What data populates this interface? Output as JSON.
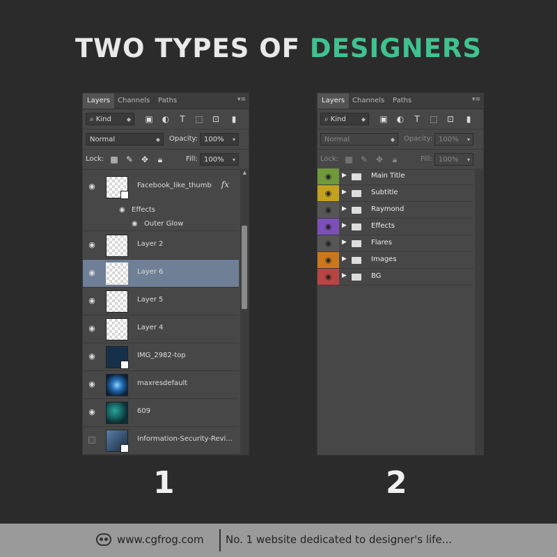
{
  "headline": {
    "part1": "TWO TYPES OF ",
    "part2": "DESIGNERS",
    "accent": "#3fc28f"
  },
  "panel_tabs": [
    "Layers",
    "Channels",
    "Paths"
  ],
  "toolbar": {
    "kind": "Kind",
    "blend_mode": "Normal",
    "opacity_label": "Opacity:",
    "opacity_value": "100%",
    "lock_label": "Lock:",
    "fill_label": "Fill:",
    "fill_value": "100%"
  },
  "panel1": {
    "layers": [
      {
        "name": "Facebook_like_thumb",
        "visible": true
      },
      {
        "name": "Layer 2",
        "visible": true
      },
      {
        "name": "Layer 6",
        "visible": true,
        "selected": true
      },
      {
        "name": "Layer 5",
        "visible": true
      },
      {
        "name": "Layer 4",
        "visible": true
      },
      {
        "name": "IMG_2982-top",
        "visible": true
      },
      {
        "name": "maxresdefault",
        "visible": true
      },
      {
        "name": "609",
        "visible": true
      },
      {
        "name": "Information-Security-Revi...",
        "visible": false
      }
    ],
    "effects_label": "Effects",
    "outer_glow_label": "Outer Glow",
    "fx_label": "fx"
  },
  "panel2": {
    "groups": [
      {
        "name": "Main Title",
        "color": "#6f9a3c"
      },
      {
        "name": "Subtitle",
        "color": "#c3a21f"
      },
      {
        "name": "Raymond",
        "color": "#565656"
      },
      {
        "name": "Effects",
        "color": "#7d4fb8"
      },
      {
        "name": "Flares",
        "color": "#565656"
      },
      {
        "name": "Images",
        "color": "#c9781d"
      },
      {
        "name": "BG",
        "color": "#b94444"
      }
    ]
  },
  "labels": {
    "one": "1",
    "two": "2"
  },
  "footer": {
    "site": "www.cgfrog.com",
    "tagline": "No. 1 website dedicated to designer's life..."
  }
}
